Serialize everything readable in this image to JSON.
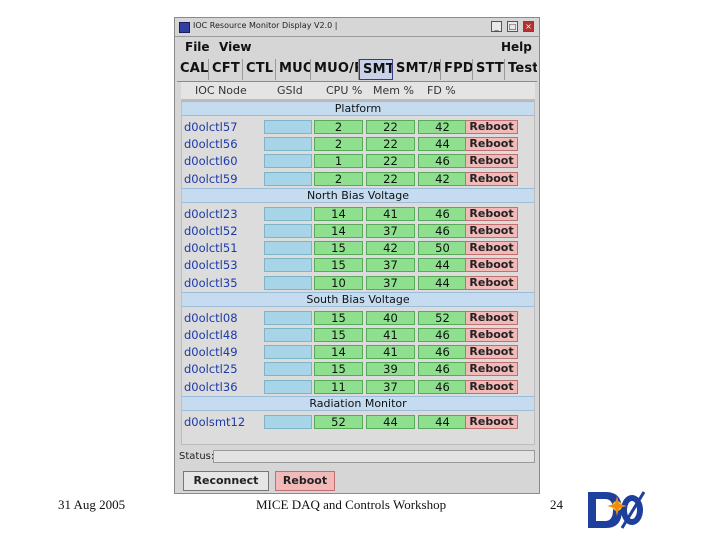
{
  "window": {
    "title": "IOC Resource Monitor Display  V2.0 |"
  },
  "menu": {
    "file": "File",
    "view": "View",
    "help": "Help"
  },
  "tabs": [
    "CAL",
    "CFT",
    "CTL",
    "MUO",
    "MUO/RC",
    "SMT",
    "SMT/RC",
    "FPD",
    "STT",
    "Test"
  ],
  "active_tab": "SMT",
  "columns": {
    "ioc_node": "IOC Node",
    "gsid": "GSId",
    "cpu": "CPU %",
    "mem": "Mem %",
    "fd": "FD %"
  },
  "sections": [
    {
      "name": "Platform",
      "rows": [
        {
          "node": "d0olctl57",
          "cpu": "2",
          "mem": "22",
          "fd": "42"
        },
        {
          "node": "d0olctl56",
          "cpu": "2",
          "mem": "22",
          "fd": "44"
        },
        {
          "node": "d0olctl60",
          "cpu": "1",
          "mem": "22",
          "fd": "46"
        },
        {
          "node": "d0olctl59",
          "cpu": "2",
          "mem": "22",
          "fd": "42"
        }
      ]
    },
    {
      "name": "North Bias Voltage",
      "rows": [
        {
          "node": "d0olctl23",
          "cpu": "14",
          "mem": "41",
          "fd": "46"
        },
        {
          "node": "d0olctl52",
          "cpu": "14",
          "mem": "37",
          "fd": "46"
        },
        {
          "node": "d0olctl51",
          "cpu": "15",
          "mem": "42",
          "fd": "50"
        },
        {
          "node": "d0olctl53",
          "cpu": "15",
          "mem": "37",
          "fd": "44"
        },
        {
          "node": "d0olctl35",
          "cpu": "10",
          "mem": "37",
          "fd": "44"
        }
      ]
    },
    {
      "name": "South Bias Voltage",
      "rows": [
        {
          "node": "d0olctl08",
          "cpu": "15",
          "mem": "40",
          "fd": "52"
        },
        {
          "node": "d0olctl48",
          "cpu": "15",
          "mem": "41",
          "fd": "46"
        },
        {
          "node": "d0olctl49",
          "cpu": "14",
          "mem": "41",
          "fd": "46"
        },
        {
          "node": "d0olctl25",
          "cpu": "15",
          "mem": "39",
          "fd": "46"
        },
        {
          "node": "d0olctl36",
          "cpu": "11",
          "mem": "37",
          "fd": "46"
        }
      ]
    },
    {
      "name": "Radiation Monitor",
      "rows": [
        {
          "node": "d0olsmt12",
          "cpu": "52",
          "mem": "44",
          "fd": "44"
        }
      ]
    }
  ],
  "reboot_label": "Reboot",
  "status": {
    "label": "Status:",
    "value": ""
  },
  "buttons": {
    "reconnect": "Reconnect",
    "reboot": "Reboot"
  },
  "slide": {
    "date": "31 Aug 2005",
    "workshop": "MICE DAQ and Controls Workshop",
    "page": "24",
    "logo": "DØ"
  },
  "colors": {
    "cell_ok": "#8ee08e",
    "gsid": "#a7d4e6",
    "section": "#c5dcf0",
    "reboot": "#f2b9b9",
    "node_text": "#1a3aa8"
  }
}
